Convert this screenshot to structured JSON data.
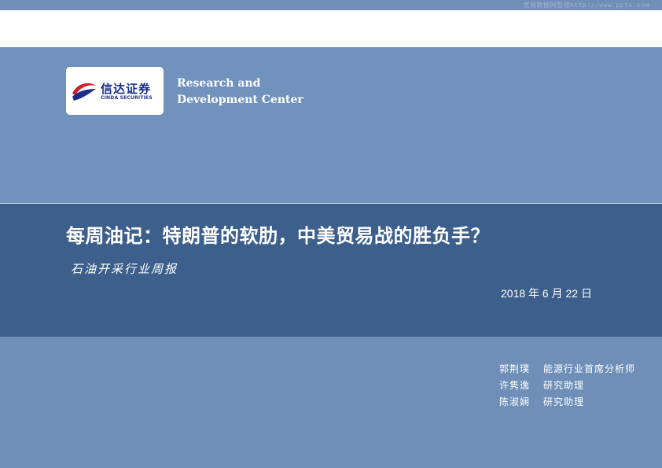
{
  "watermark": "优易数据网整理http://www.pptx.com",
  "logo": {
    "cn_name": "信达证券",
    "en_name": "CINDA SECURITIES",
    "mark_colors": {
      "red": "#d0202e",
      "blue": "#1b2f8a"
    }
  },
  "center": {
    "line1": "Research and",
    "line2": "Development Center"
  },
  "report": {
    "title": "每周油记：特朗普的软肋，中美贸易战的胜负手？",
    "subtitle": "石油开采行业周报",
    "date": "2018 年 6 月 22 日"
  },
  "authors": [
    {
      "name": "郭荆璞",
      "role": "能源行业首席分析师"
    },
    {
      "name": "许隽逸",
      "role": "研究助理"
    },
    {
      "name": "陈淑娴",
      "role": "研究助理"
    }
  ],
  "colors": {
    "background": "#6f8fb8",
    "title_band": "#3d5f8c",
    "white_band": "#ffffff"
  }
}
